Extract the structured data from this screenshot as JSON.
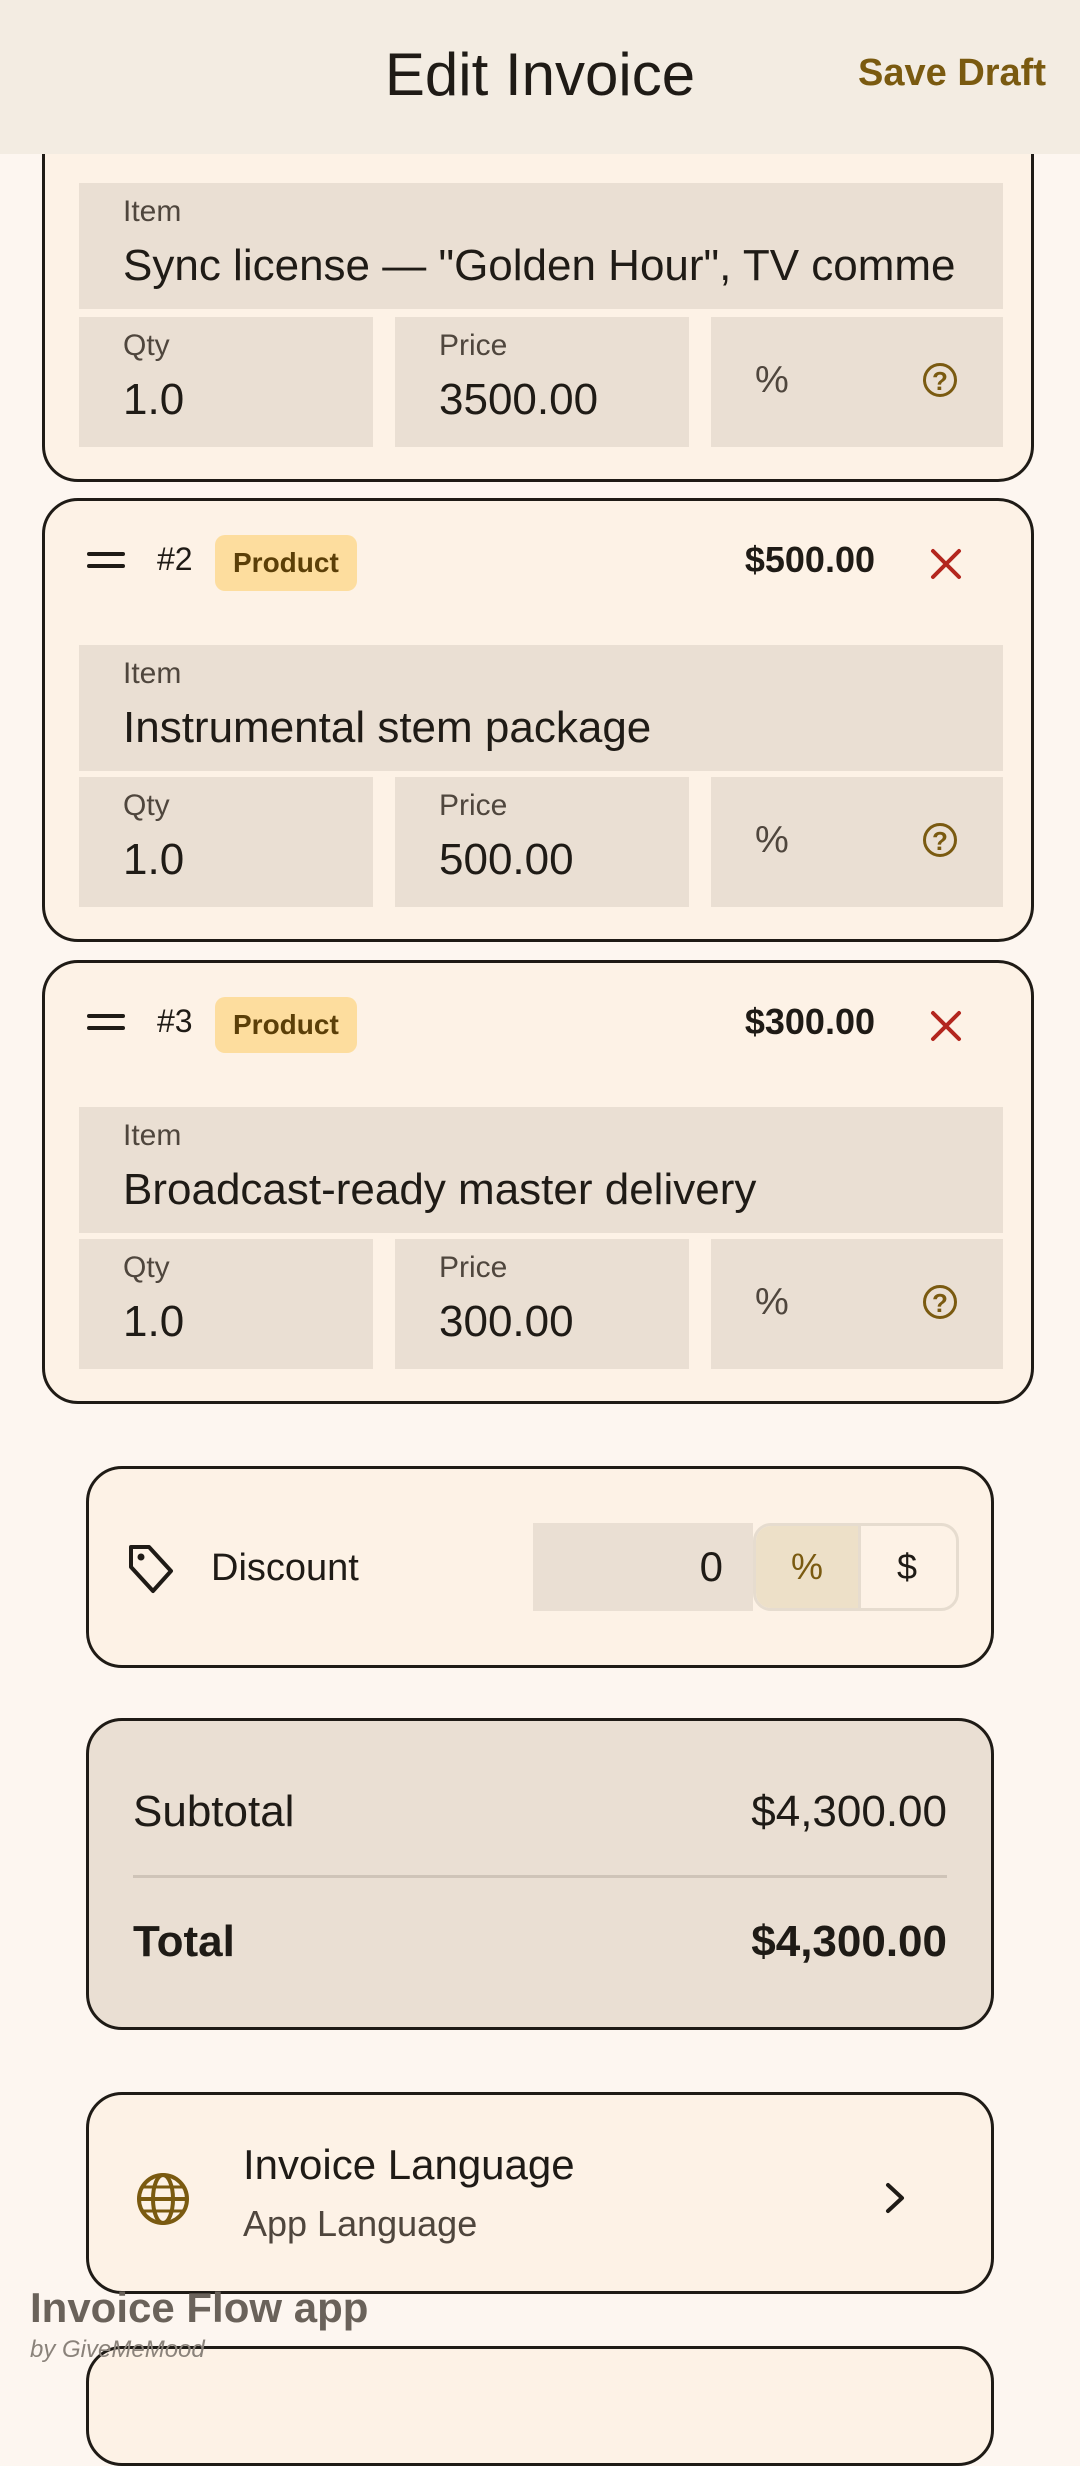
{
  "header": {
    "title": "Edit Invoice",
    "save_label": "Save Draft"
  },
  "line_items": [
    {
      "number": "",
      "type": "",
      "amount": "",
      "item_label": "Item",
      "item": "Sync license — \"Golden Hour\", TV comme",
      "qty_label": "Qty",
      "qty": "1.0",
      "price_label": "Price",
      "price": "3500.00",
      "discount_unit": "%",
      "help_icon": "help-circle-icon"
    },
    {
      "number": "#2",
      "type": "Product",
      "amount": "$500.00",
      "item_label": "Item",
      "item": "Instrumental stem package",
      "qty_label": "Qty",
      "qty": "1.0",
      "price_label": "Price",
      "price": "500.00",
      "discount_unit": "%",
      "help_icon": "help-circle-icon"
    },
    {
      "number": "#3",
      "type": "Product",
      "amount": "$300.00",
      "item_label": "Item",
      "item": "Broadcast-ready master delivery",
      "qty_label": "Qty",
      "qty": "1.0",
      "price_label": "Price",
      "price": "300.00",
      "discount_unit": "%",
      "help_icon": "help-circle-icon"
    }
  ],
  "discount": {
    "label": "Discount",
    "value": "0",
    "mode_percent": "%",
    "mode_amount": "$",
    "selected": "%"
  },
  "totals": {
    "subtotal_label": "Subtotal",
    "subtotal": "$4,300.00",
    "total_label": "Total",
    "total": "$4,300.00"
  },
  "language": {
    "title": "Invoice Language",
    "subtitle": "App Language"
  },
  "watermark": {
    "app": "Invoice Flow app",
    "by": "by GiveMeMood"
  },
  "colors": {
    "accent": "#7a5a10",
    "remove": "#b3261e",
    "badge_bg": "#fddd9e",
    "card_bg": "#fdf2e6",
    "field_bg": "#eadfd3"
  }
}
